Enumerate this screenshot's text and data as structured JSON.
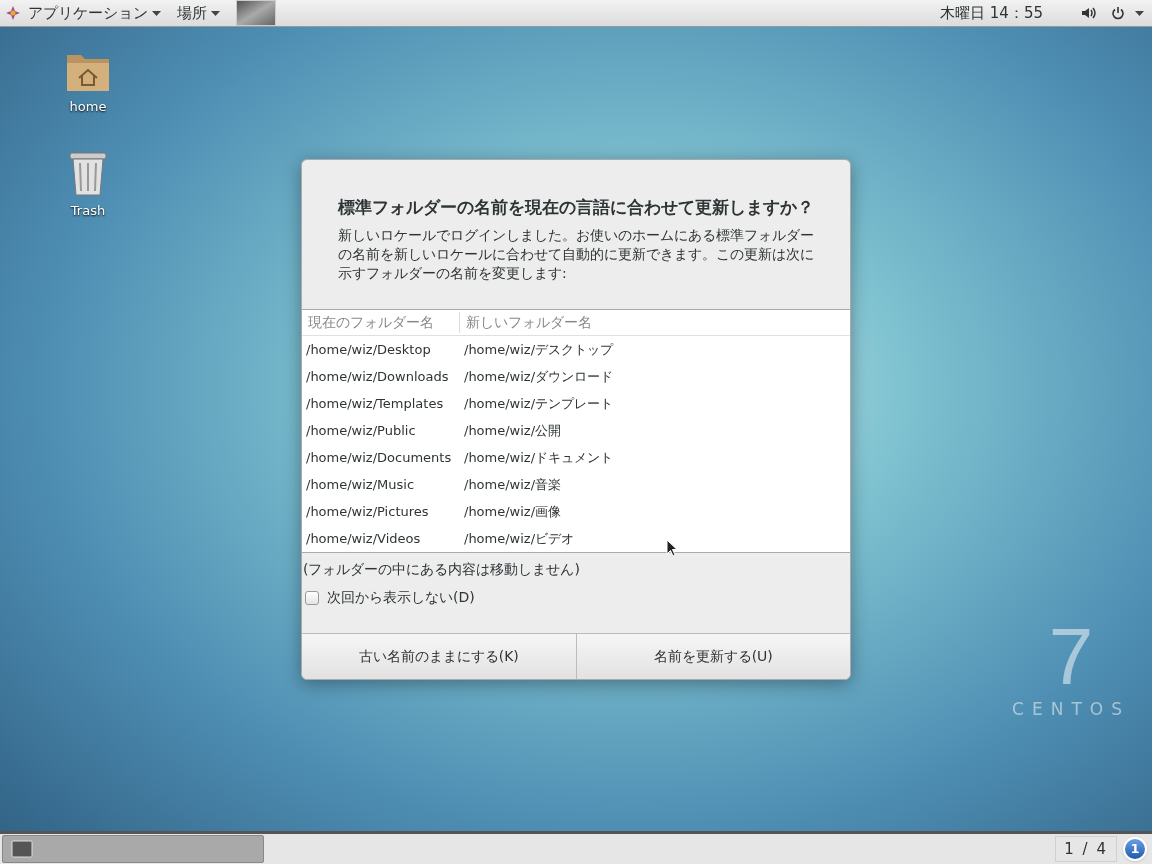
{
  "top_panel": {
    "applications_menu": "アプリケーション",
    "places_menu": "場所",
    "clock": "木曜日 14：55"
  },
  "desktop_icons": [
    {
      "kind": "folder",
      "label": "home"
    },
    {
      "kind": "trash",
      "label": "Trash"
    }
  ],
  "branding": {
    "number": "7",
    "name": "CENTOS"
  },
  "dialog": {
    "title": "標準フォルダーの名前を現在の言語に合わせて更新しますか？",
    "message": "新しいロケールでログインしました。お使いのホームにある標準フォルダーの名前を新しいロケールに合わせて自動的に更新できます。この更新は次に示すフォルダーの名前を変更します:",
    "table": {
      "columns": [
        "現在のフォルダー名",
        "新しいフォルダー名"
      ],
      "rows": [
        [
          "/home/wiz/Desktop",
          "/home/wiz/デスクトップ"
        ],
        [
          "/home/wiz/Downloads",
          "/home/wiz/ダウンロード"
        ],
        [
          "/home/wiz/Templates",
          "/home/wiz/テンプレート"
        ],
        [
          "/home/wiz/Public",
          "/home/wiz/公開"
        ],
        [
          "/home/wiz/Documents",
          "/home/wiz/ドキュメント"
        ],
        [
          "/home/wiz/Music",
          "/home/wiz/音楽"
        ],
        [
          "/home/wiz/Pictures",
          "/home/wiz/画像"
        ],
        [
          "/home/wiz/Videos",
          "/home/wiz/ビデオ"
        ]
      ]
    },
    "note": "(フォルダーの中にある内容は移動しません)",
    "checkbox": {
      "label": "次回から表示しない(D)",
      "checked": false
    },
    "buttons": [
      "古い名前のままにする(K)",
      "名前を更新する(U)"
    ]
  },
  "bottom_panel": {
    "workspace": "1 / 4",
    "notification_count": "1"
  }
}
